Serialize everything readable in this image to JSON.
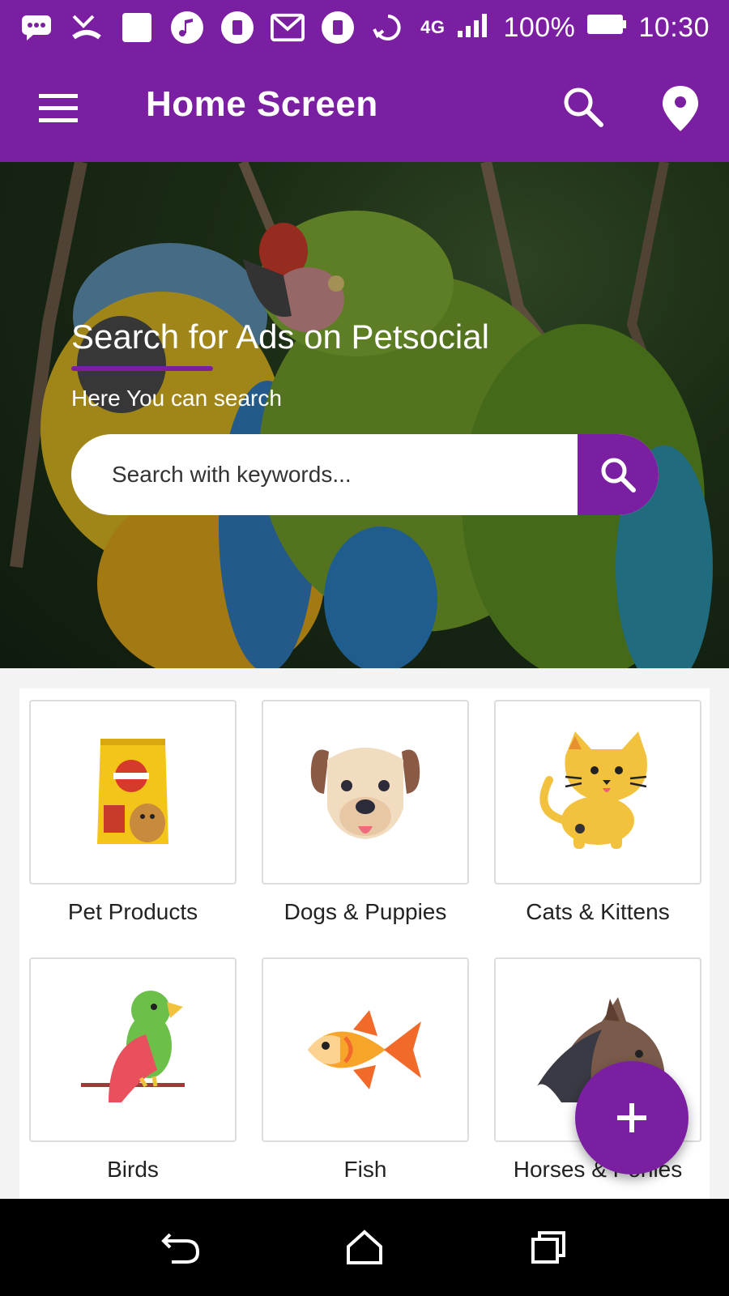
{
  "status_bar": {
    "network": "4G",
    "battery": "100%",
    "time": "10:30"
  },
  "app_bar": {
    "title": "Home Screen"
  },
  "hero": {
    "title": "Search for Ads on Petsocial",
    "subtitle": "Here You can search",
    "search_placeholder": "Search with keywords..."
  },
  "categories": [
    {
      "label": "Pet Products",
      "icon": "pet-food-bag-icon"
    },
    {
      "label": "Dogs & Puppies",
      "icon": "dog-face-icon"
    },
    {
      "label": "Cats & Kittens",
      "icon": "cat-icon"
    },
    {
      "label": "Birds",
      "icon": "parrot-icon"
    },
    {
      "label": "Fish",
      "icon": "fish-icon"
    },
    {
      "label": "Horses & Ponies",
      "icon": "horse-icon"
    }
  ],
  "fab": {
    "icon": "plus-icon"
  },
  "colors": {
    "primary": "#7b1fa2",
    "accent": "#ffffff"
  }
}
